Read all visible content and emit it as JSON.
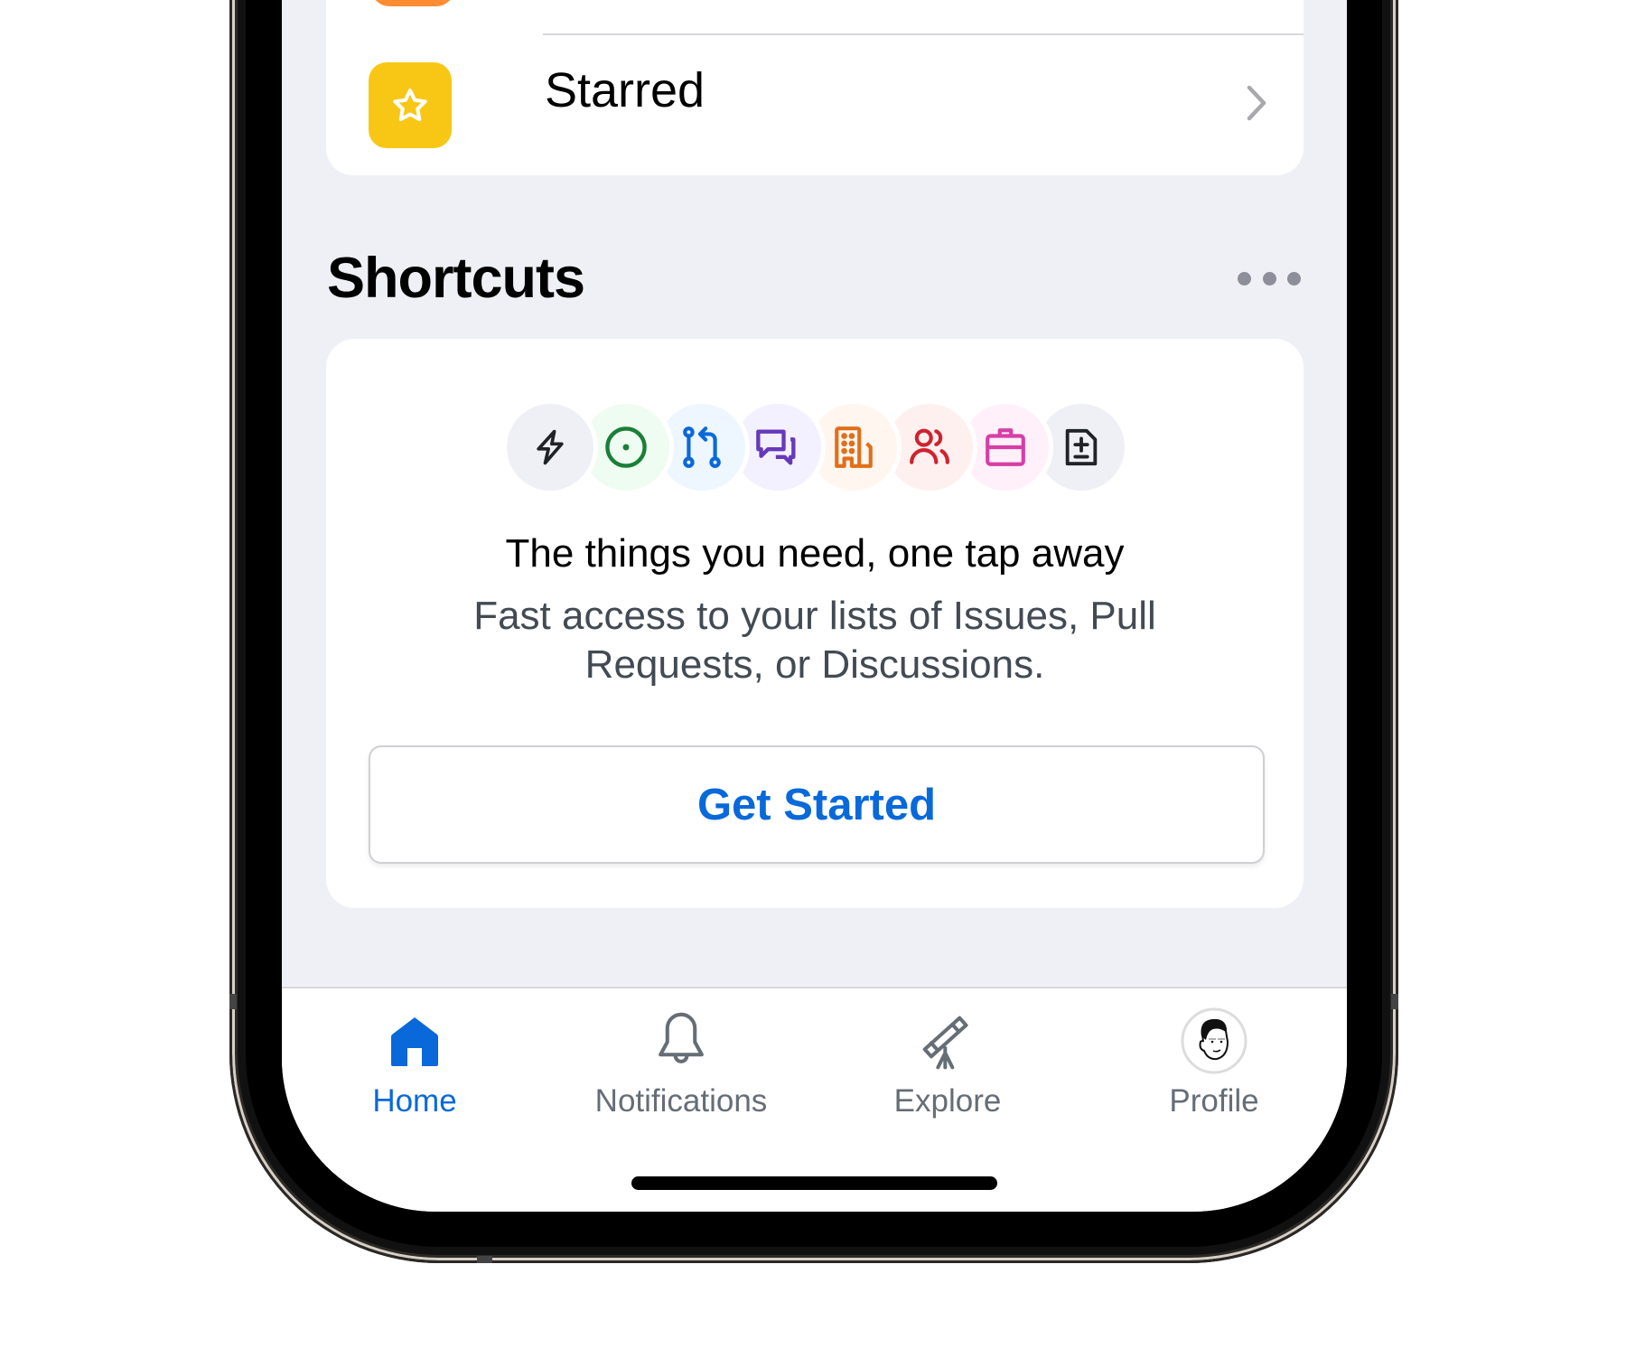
{
  "list_card": {
    "items": [
      {
        "label": "",
        "icon": "orange-tile-icon",
        "color": "#fd8c33"
      },
      {
        "label": "Starred",
        "icon": "star-icon",
        "color": "#f8c716"
      }
    ]
  },
  "shortcuts": {
    "title": "Shortcuts",
    "more_icon": "more-horizontal-icon",
    "icons": [
      {
        "name": "zap-icon",
        "color": "#1f2328",
        "bg": "#eff0f5"
      },
      {
        "name": "issue-open-icon",
        "color": "#1a7f37",
        "bg": "#effcf1"
      },
      {
        "name": "pull-request-icon",
        "color": "#0969da",
        "bg": "#eef6ff"
      },
      {
        "name": "discussions-icon",
        "color": "#6639ba",
        "bg": "#f3f0ff"
      },
      {
        "name": "organization-icon",
        "color": "#e16f1a",
        "bg": "#fff6ef"
      },
      {
        "name": "people-icon",
        "color": "#cf222e",
        "bg": "#fff0f0"
      },
      {
        "name": "briefcase-icon",
        "color": "#d63fa5",
        "bg": "#fff0f9"
      },
      {
        "name": "file-diff-icon",
        "color": "#1f2328",
        "bg": "#eff0f5"
      }
    ],
    "heading": "The things you need, one tap away",
    "description": "Fast access to your lists of Issues, Pull Requests, or Discussions.",
    "button_label": "Get Started"
  },
  "tabbar": {
    "tabs": [
      {
        "label": "Home",
        "icon": "home-icon",
        "active": true
      },
      {
        "label": "Notifications",
        "icon": "bell-icon",
        "active": false
      },
      {
        "label": "Explore",
        "icon": "telescope-icon",
        "active": false
      },
      {
        "label": "Profile",
        "icon": "avatar",
        "active": false
      }
    ]
  },
  "colors": {
    "accent": "#0969da",
    "background": "#eff0f5",
    "muted_text": "#656d76"
  }
}
